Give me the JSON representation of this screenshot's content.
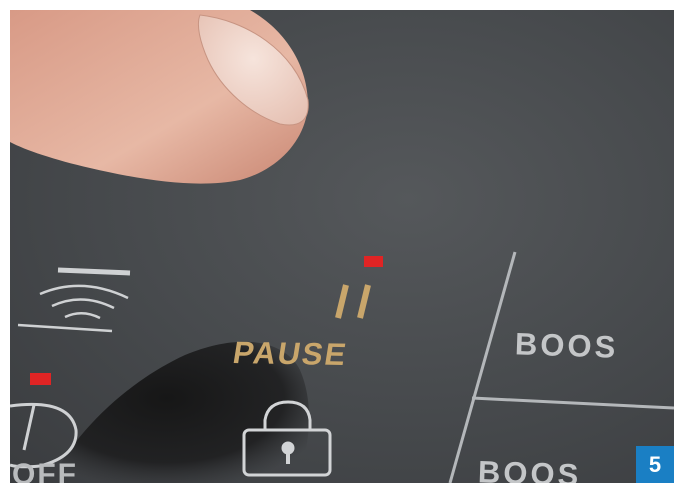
{
  "panel": {
    "pause_label": "PAUSE",
    "boost_label_1": "BOOS",
    "boost_label_2": "BOOS",
    "off_label": "OFF"
  },
  "badge": {
    "number": "5"
  },
  "colors": {
    "panel_background": "#46494c",
    "indicator_red": "#e02424",
    "pause_gold": "#c9a66b",
    "label_gray": "#c4c6c8",
    "badge_blue": "#1a7fc4"
  },
  "icons": [
    "wifi-icon",
    "pause-icon",
    "lock-icon",
    "power-icon"
  ]
}
